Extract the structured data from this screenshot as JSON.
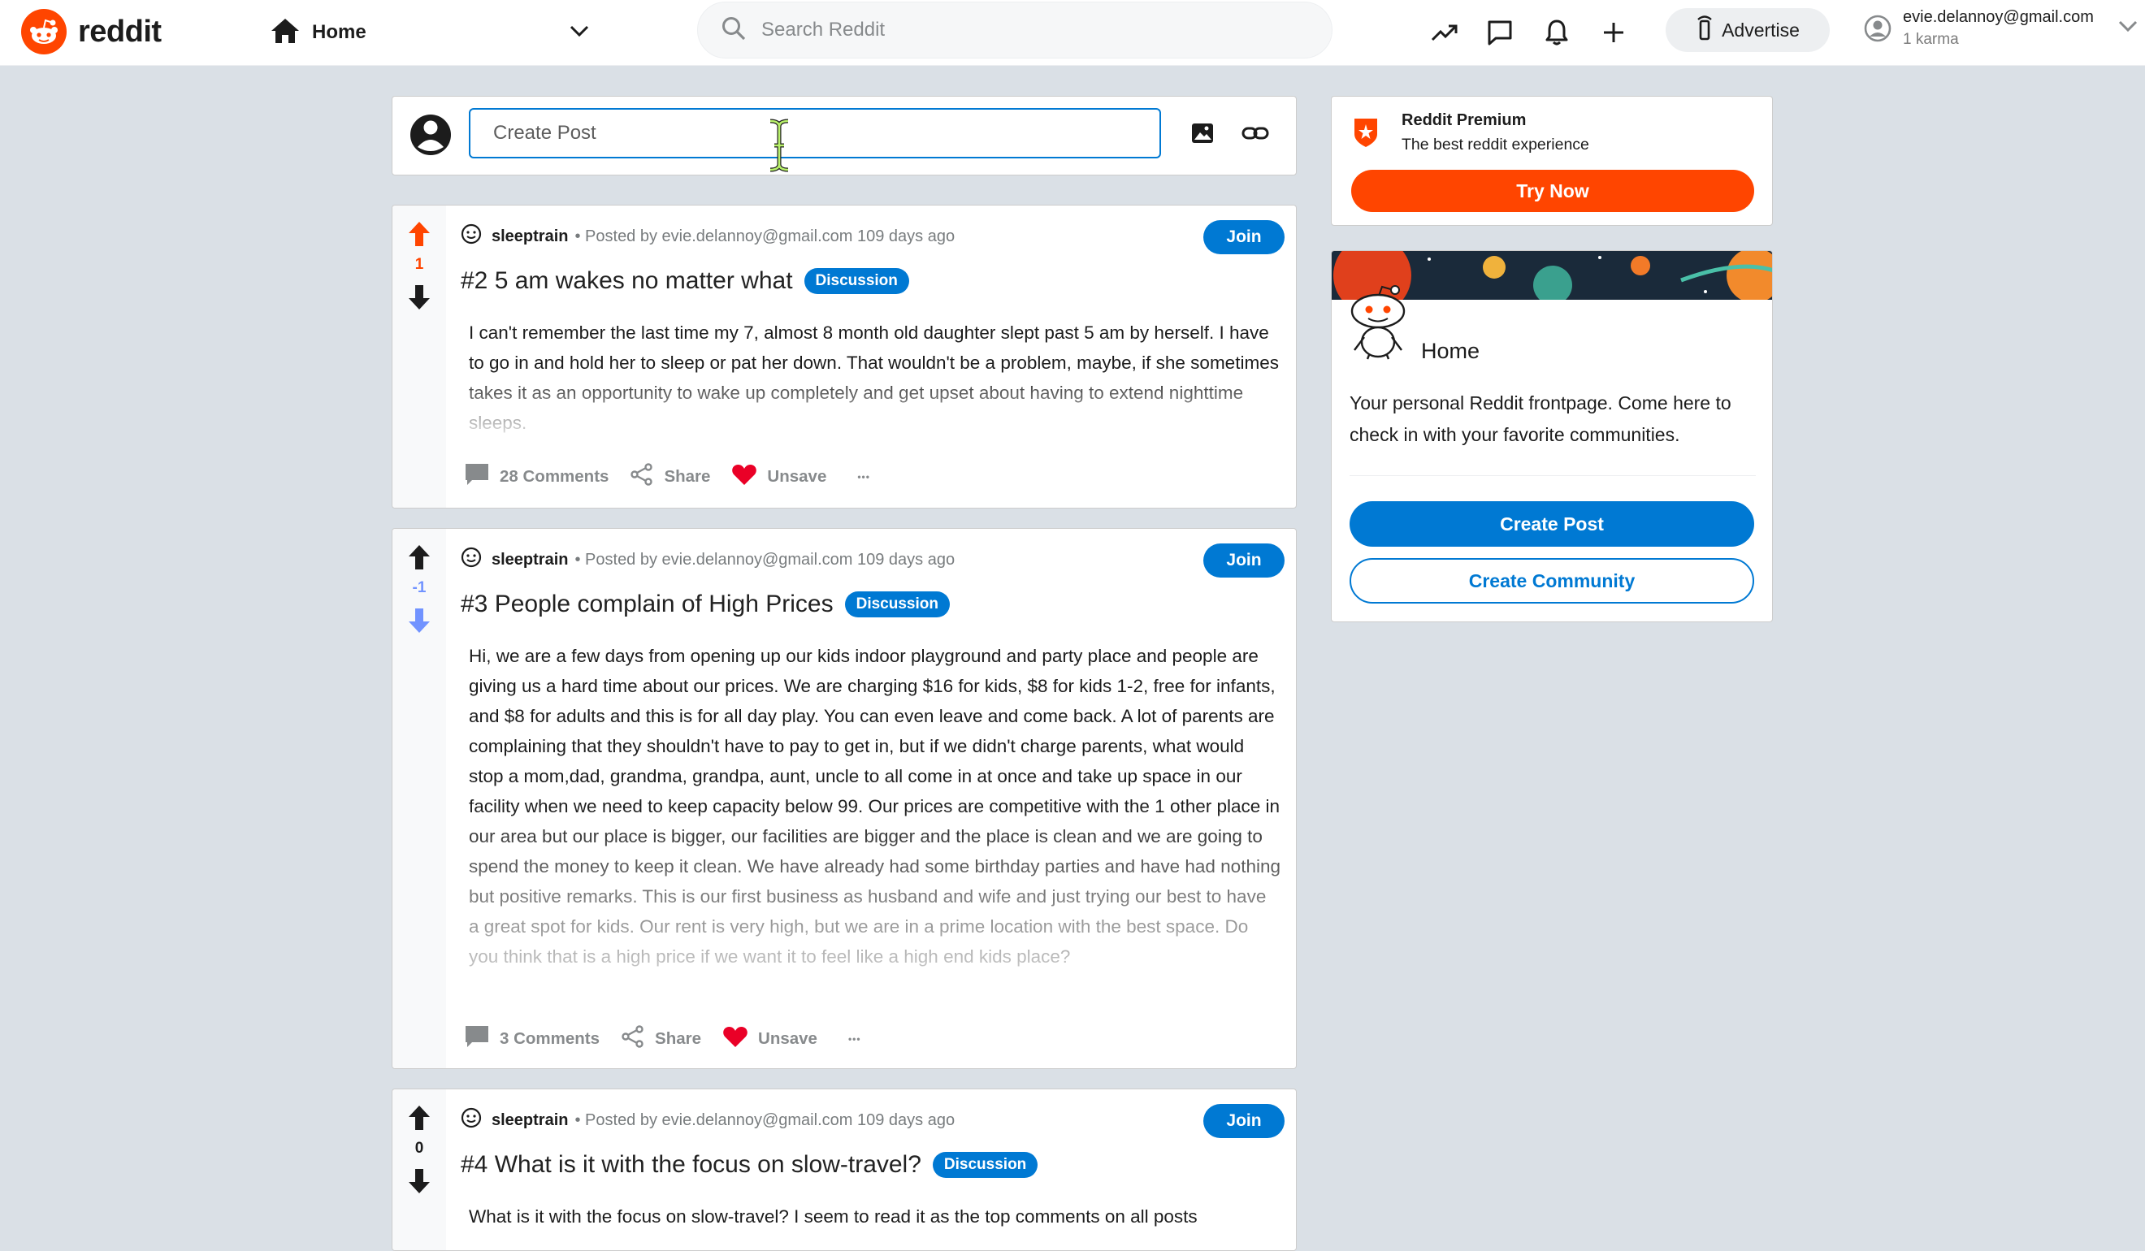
{
  "header": {
    "logo_text": "reddit",
    "home_label": "Home",
    "search_placeholder": "Search Reddit",
    "advertise_label": "Advertise",
    "user_name": "evie.delannoy@gmail.com",
    "user_karma": "1 karma"
  },
  "create_post": {
    "placeholder": "Create Post"
  },
  "posts": [
    {
      "subreddit": "sleeptrain",
      "byline": "• Posted by evie.delannoy@gmail.com 109 days ago",
      "join_label": "Join",
      "score": "1",
      "vote_state": "upvoted",
      "title": "#2 5 am wakes no matter what",
      "flair": "Discussion",
      "body": "I can't remember the last time my 7, almost 8 month old daughter slept past 5 am by herself. I have to go in and hold her to sleep or pat her down. That wouldn't be a problem, maybe, if she sometimes takes it as an opportunity to wake up completely and get upset about having to extend nighttime sleeps.",
      "comments": "28 Comments",
      "share": "Share",
      "unsave": "Unsave",
      "more": "•••"
    },
    {
      "subreddit": "sleeptrain",
      "byline": "• Posted by evie.delannoy@gmail.com 109 days ago",
      "join_label": "Join",
      "score": "-1",
      "vote_state": "downvoted",
      "title": "#3 People complain of High Prices",
      "flair": "Discussion",
      "body": "Hi, we are a few days from opening up our kids indoor playground and party place and people are giving us a hard time about our prices. We are charging $16 for kids, $8 for kids 1-2, free for infants, and $8 for adults and this is for all day play. You can even leave and come back. A lot of parents are complaining that they shouldn't have to pay to get in, but if we didn't charge parents, what would stop a mom,dad, grandma, grandpa, aunt, uncle to all come in at once and take up space in our facility when we need to keep capacity below 99. Our prices are competitive with the 1 other place in our area but our place is bigger, our facilities are bigger and the place is clean and we are going to spend the money to keep it clean. We have already had some birthday parties and have had nothing but positive remarks. This is our first business as husband and wife and just trying our best to have a great spot for kids. Our rent is very high, but we are in a prime location with the best space. Do you think that is a high price if we want it to feel like a high end kids place?",
      "comments": "3 Comments",
      "share": "Share",
      "unsave": "Unsave",
      "more": "•••"
    },
    {
      "subreddit": "sleeptrain",
      "byline": "• Posted by evie.delannoy@gmail.com 109 days ago",
      "join_label": "Join",
      "score": "0",
      "vote_state": "none",
      "title": "#4 What is it with the focus on slow-travel?",
      "flair": "Discussion",
      "body": "What is it with the focus on slow-travel? I seem to read it as the top comments on all posts"
    }
  ],
  "sidebar": {
    "premium_title": "Reddit Premium",
    "premium_subtitle": "The best reddit experience",
    "try_now": "Try Now",
    "home_title": "Home",
    "home_desc": "Your personal Reddit frontpage. Come here to check in with your favorite communities.",
    "create_post": "Create Post",
    "create_community": "Create Community"
  },
  "colors": {
    "accent": "#0079d3",
    "brand": "#ff4500",
    "upvote": "#ff4500",
    "downvote": "#7193ff",
    "heart": "#ea0027"
  },
  "icons": [
    "reddit-logo-icon",
    "home-icon",
    "chevron-down-icon",
    "search-icon",
    "trending-icon",
    "chat-icon",
    "bell-icon",
    "plus-icon",
    "advertise-icon",
    "user-avatar-icon",
    "image-icon",
    "link-icon",
    "upvote-icon",
    "downvote-icon",
    "subreddit-icon",
    "comment-icon",
    "share-icon",
    "heart-icon",
    "more-icon",
    "premium-shield-icon",
    "snoo-icon",
    "text-cursor-icon"
  ]
}
